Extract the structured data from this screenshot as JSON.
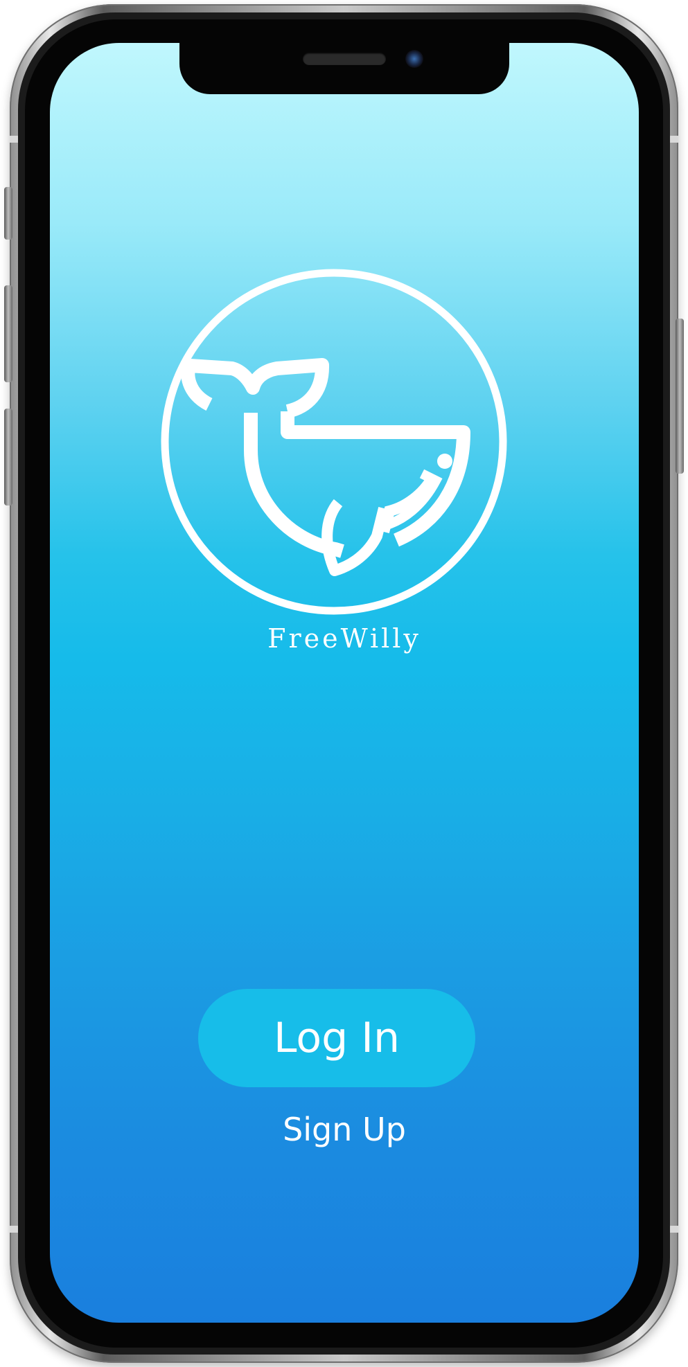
{
  "app": {
    "name": "FreeWilly",
    "logo_icon": "whale-icon"
  },
  "actions": {
    "login_label": "Log In",
    "signup_label": "Sign Up"
  },
  "colors": {
    "gradient_top": "#c0f7fd",
    "gradient_mid": "#16bbea",
    "gradient_bottom": "#1a7fde",
    "login_button": "#17bde9",
    "text": "#ffffff"
  }
}
